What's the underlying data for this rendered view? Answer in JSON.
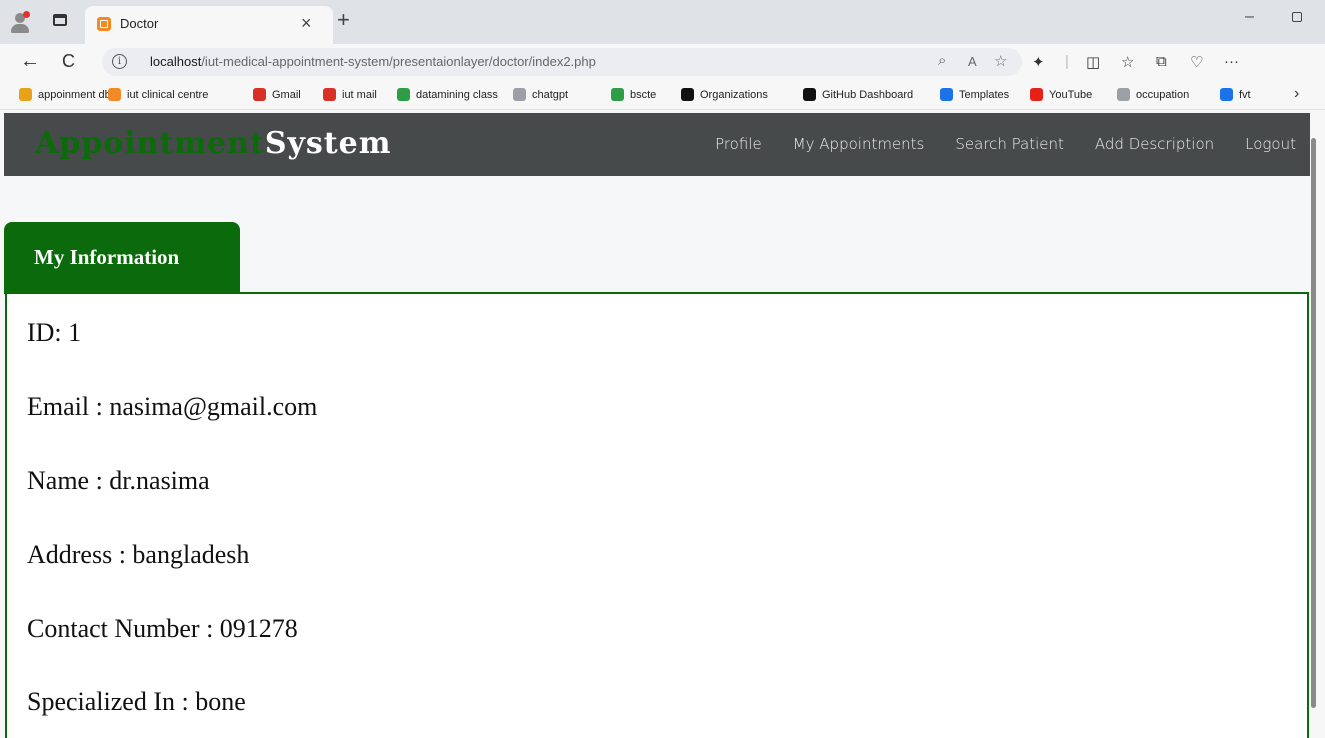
{
  "browser": {
    "tab_title": "Doctor",
    "tab_close": "×",
    "new_tab": "+",
    "minimize": "–",
    "url_host": "localhost",
    "url_path": "/iut-medical-appointment-system/presentaionlayer/doctor/index2.php",
    "back": "←",
    "refresh": "C",
    "info": "i",
    "more": "···",
    "bookmarks_more": "›",
    "bookmarks": [
      {
        "label": "appoinment db",
        "color": "#e8a21a"
      },
      {
        "label": "iut clinical centre",
        "color": "#f28b25"
      },
      {
        "label": "Gmail",
        "color": "#d93025"
      },
      {
        "label": "iut mail",
        "color": "#d93025"
      },
      {
        "label": "datamining class",
        "color": "#2e9e46"
      },
      {
        "label": "chatgpt",
        "color": "#9aa0a6"
      },
      {
        "label": "bscte",
        "color": "#2e9e46"
      },
      {
        "label": "Organizations",
        "color": "#111111"
      },
      {
        "label": "GitHub Dashboard",
        "color": "#111111"
      },
      {
        "label": "Templates",
        "color": "#1a73e8"
      },
      {
        "label": "YouTube",
        "color": "#e62117"
      },
      {
        "label": "occupation",
        "color": "#9aa0a6"
      },
      {
        "label": "fvt",
        "color": "#1a73e8"
      }
    ]
  },
  "navbar": {
    "brand_part1": "Appointment",
    "brand_part2": "System",
    "links": [
      "Profile",
      "My Appointments",
      "Search Patient",
      "Add Description",
      "Logout"
    ]
  },
  "info": {
    "tab_label": "My Information",
    "fields": [
      "ID: 1",
      "Email : nasima@gmail.com",
      "Name : dr.nasima",
      "Address : bangladesh",
      "Contact Number : 091278",
      "Specialized In : bone"
    ]
  },
  "colors": {
    "brand_green": "#0a6b08",
    "navbar_bg": "#474a4b",
    "tab_green": "#0b6a0b"
  }
}
